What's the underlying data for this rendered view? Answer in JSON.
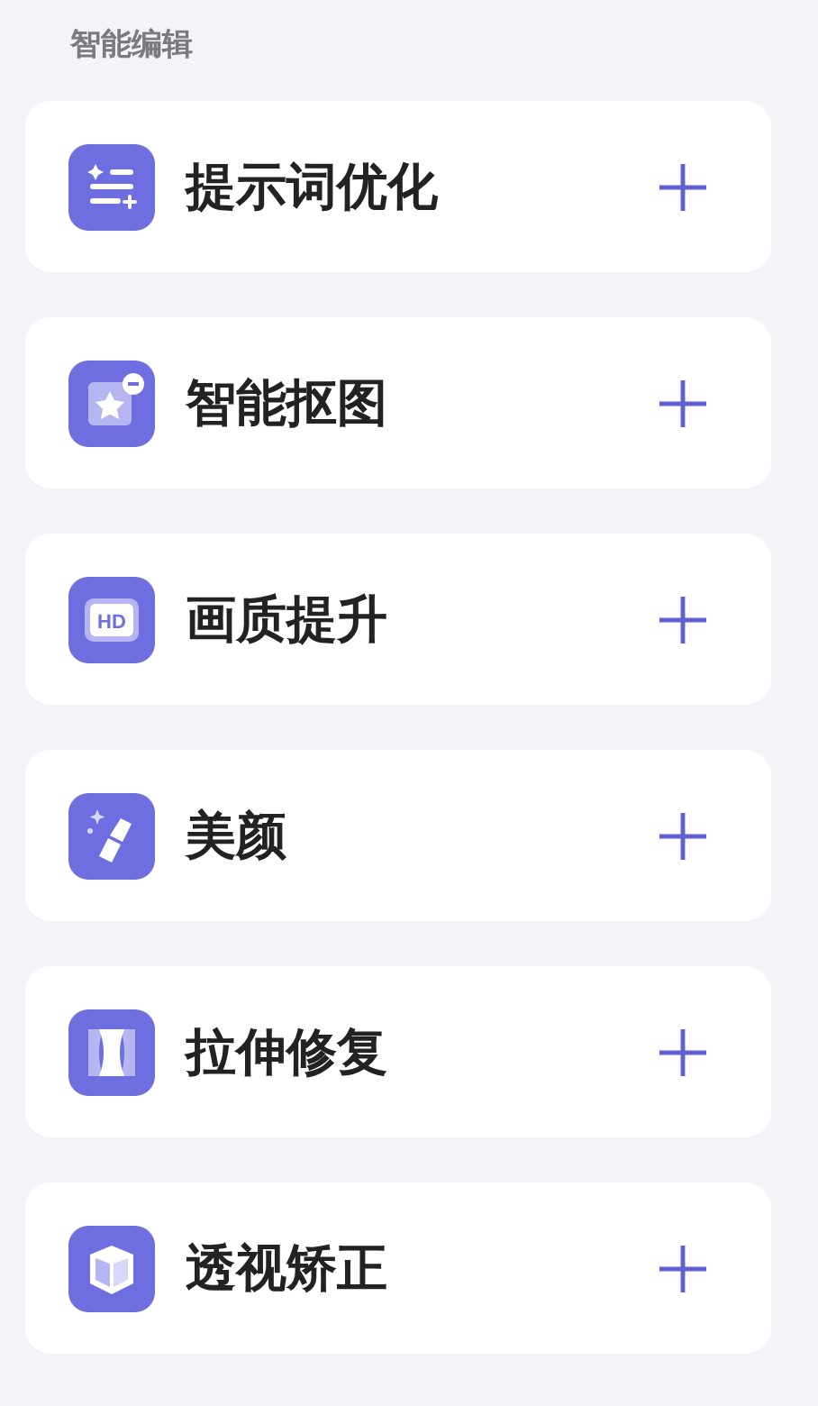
{
  "section_title": "智能编辑",
  "tools": [
    {
      "kind": "prompt",
      "label": "提示词优化"
    },
    {
      "kind": "cutout",
      "label": "智能抠图"
    },
    {
      "kind": "hd",
      "label": "画质提升",
      "icon_text": "HD"
    },
    {
      "kind": "beauty",
      "label": "美颜"
    },
    {
      "kind": "stretch",
      "label": "拉伸修复"
    },
    {
      "kind": "perspective",
      "label": "透视矫正"
    }
  ]
}
